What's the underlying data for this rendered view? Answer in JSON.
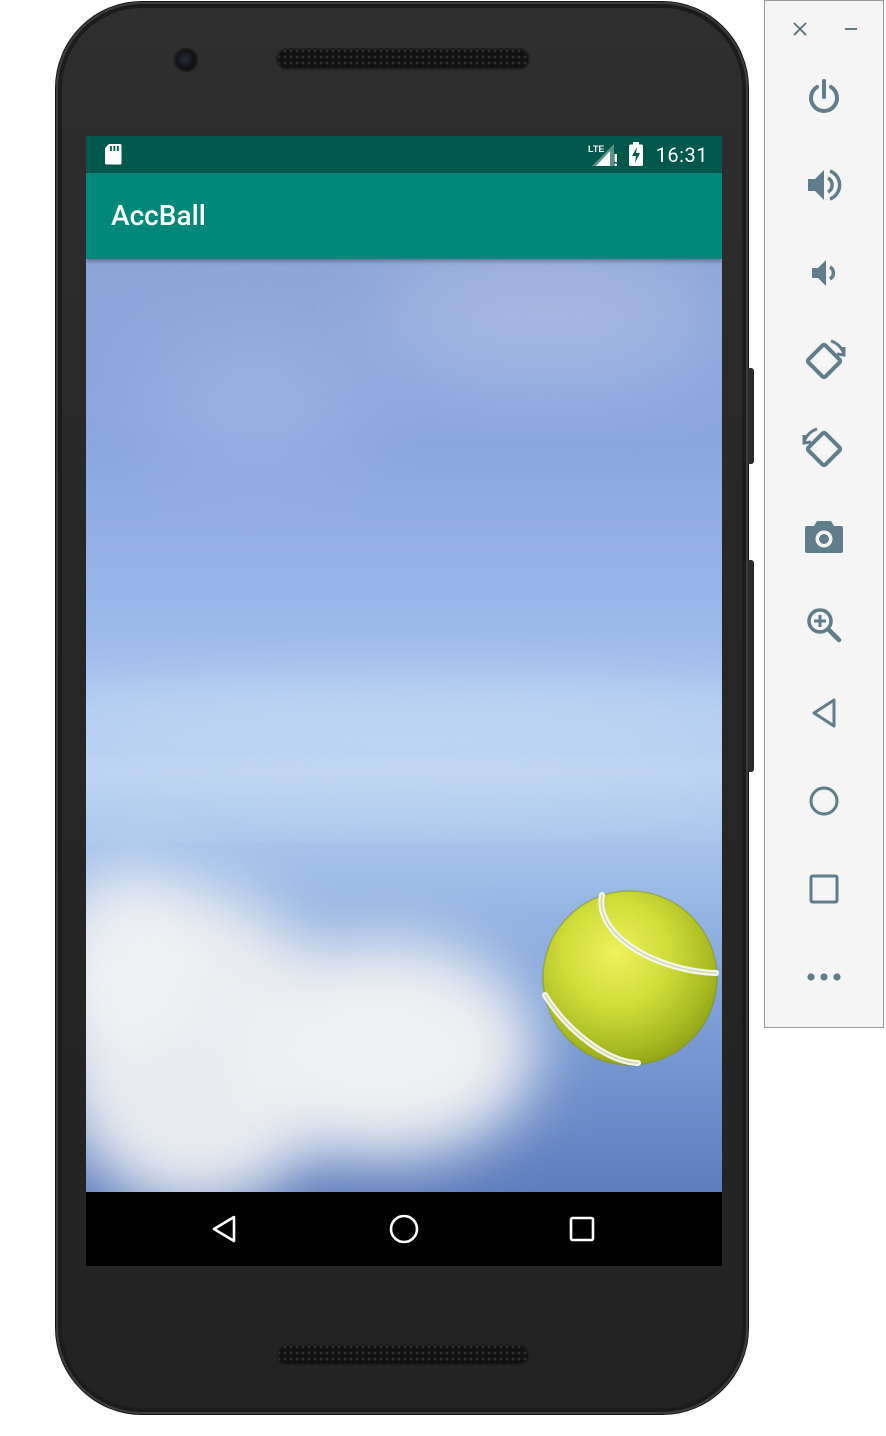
{
  "statusbar": {
    "time": "16:31",
    "network": "LTE"
  },
  "app": {
    "title": "AccBall"
  },
  "colors": {
    "status_bar": "#00574b",
    "app_bar": "#00897b",
    "tool_icon": "#607d8b"
  },
  "navbar": {
    "buttons": [
      "back-icon",
      "home-icon",
      "recents-icon"
    ]
  },
  "emulator_toolbar": {
    "window": [
      "close-icon",
      "minimize-icon"
    ],
    "buttons": [
      "power-icon",
      "volume-up-icon",
      "volume-down-icon",
      "rotate-left-icon",
      "rotate-right-icon",
      "camera-icon",
      "zoom-icon",
      "back-icon",
      "home-icon",
      "overview-icon",
      "more-icon"
    ]
  }
}
